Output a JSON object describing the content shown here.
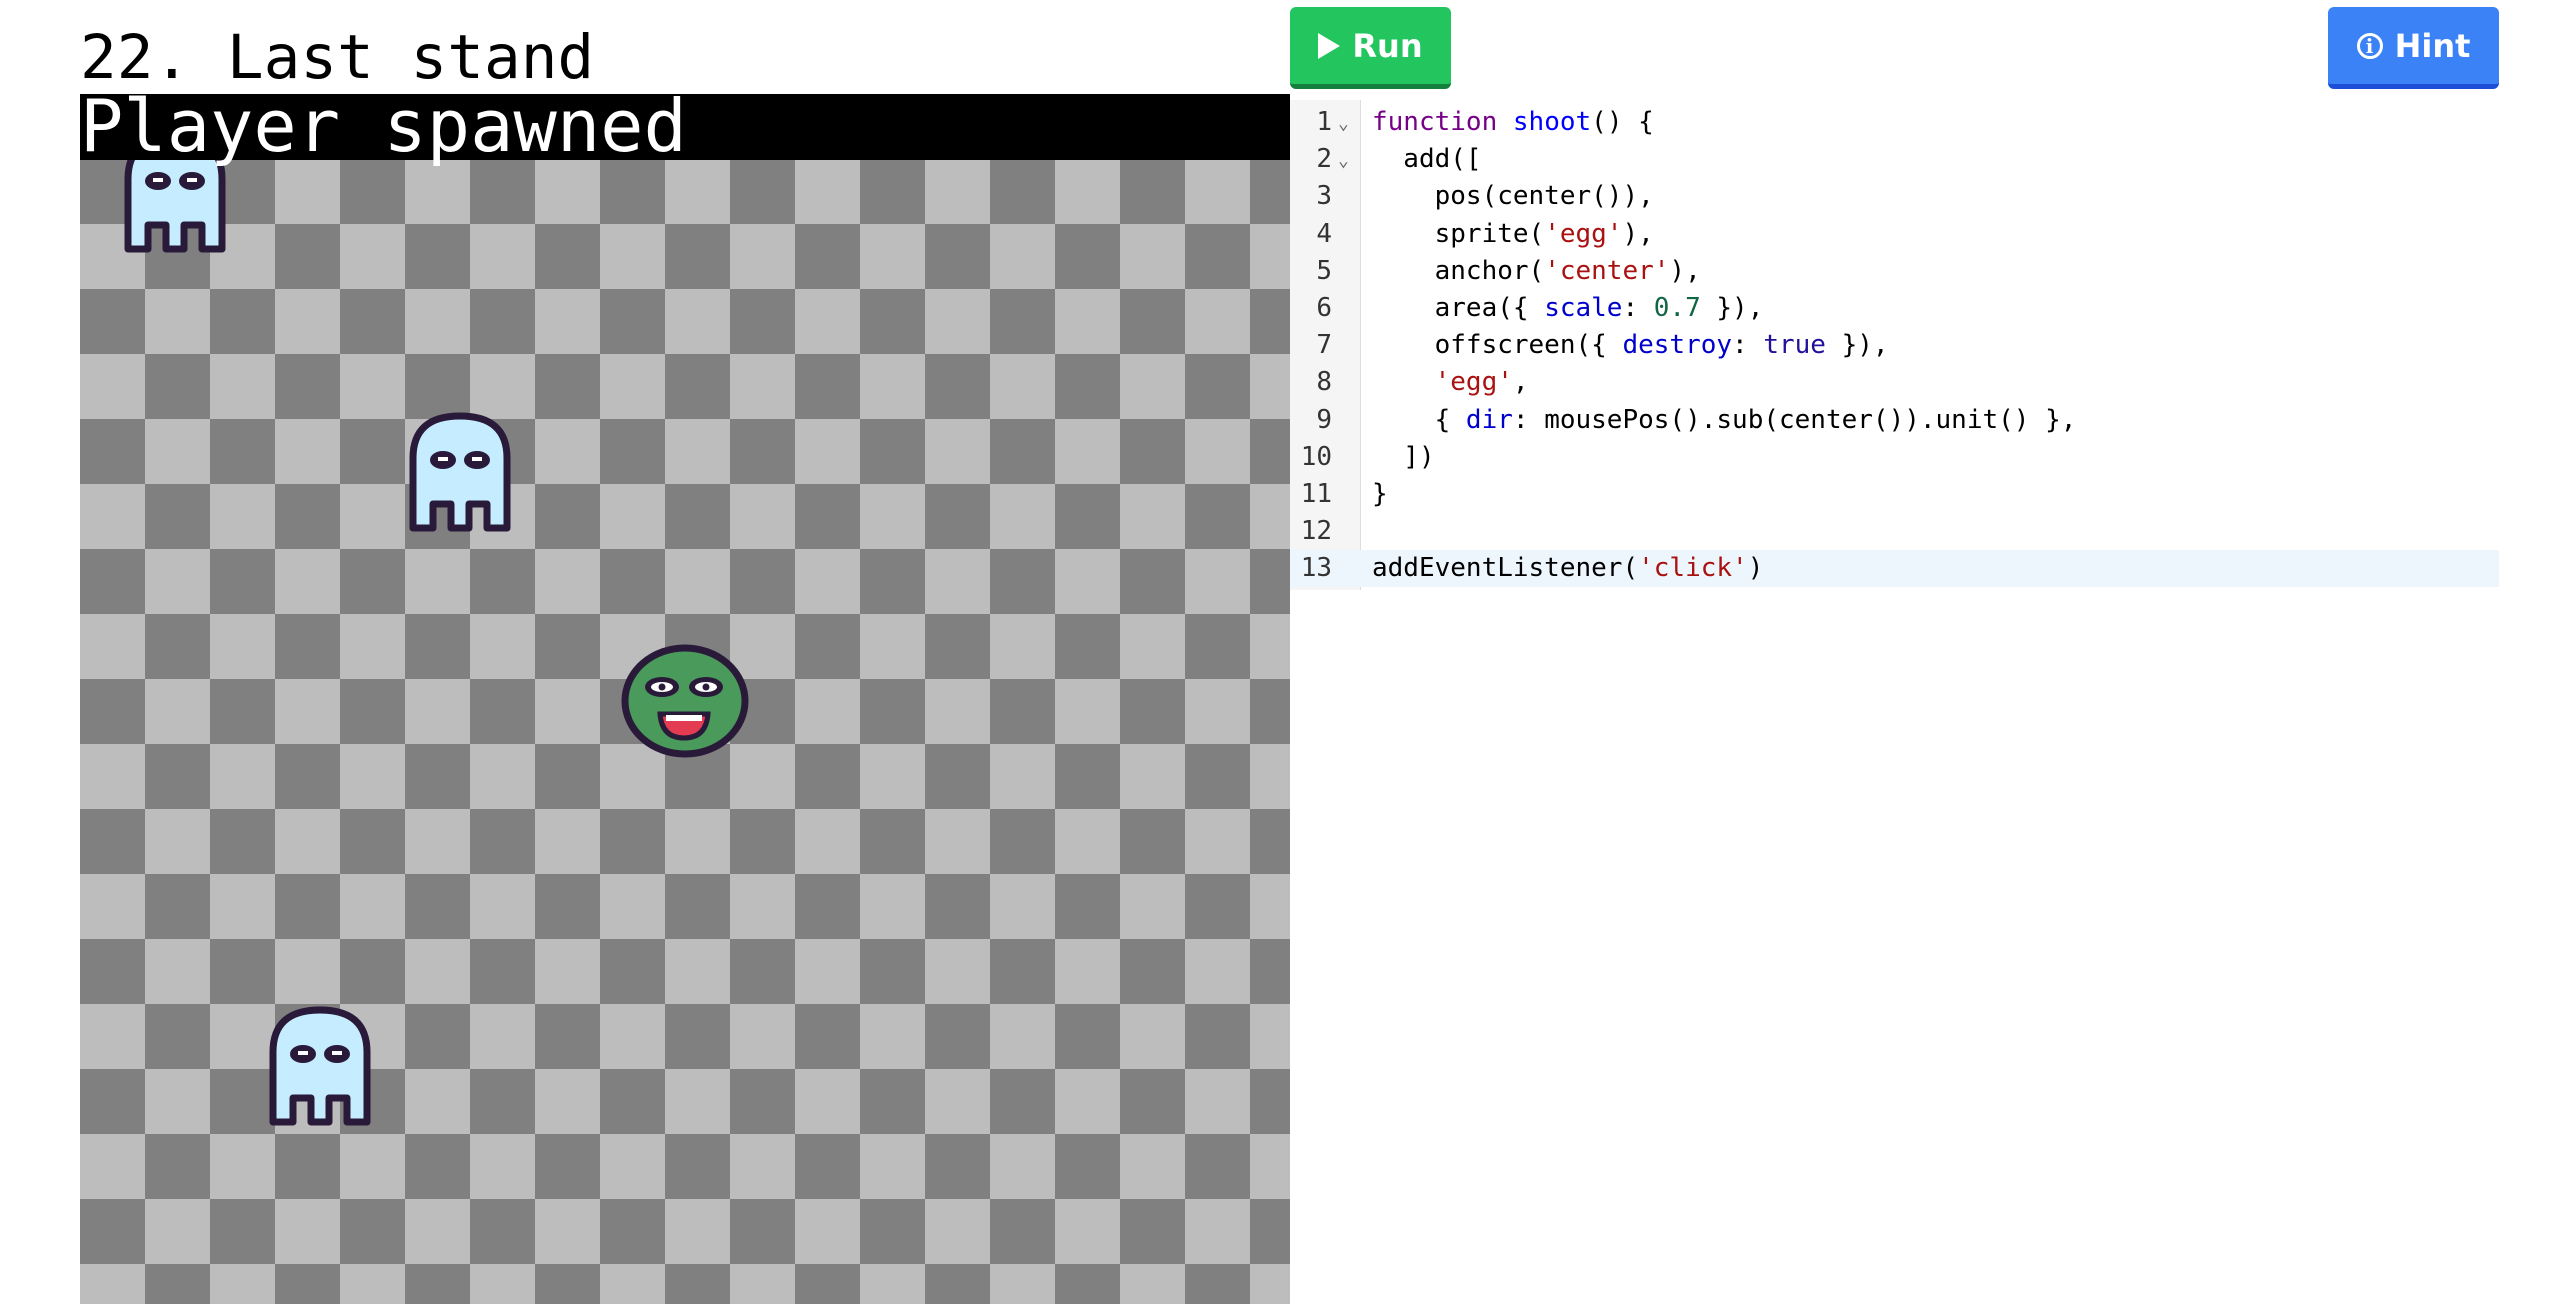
{
  "title": "22. Last stand",
  "status": "Player spawned",
  "buttons": {
    "run": "Run",
    "hint": "Hint"
  },
  "game": {
    "colors": {
      "checker_dark": "#808080",
      "checker_light": "#bdbdbd",
      "ghosty": "#c5ecff",
      "player": "#4a9a5b"
    },
    "sprites": [
      "ghosty",
      "ghosty",
      "ghosty",
      "player"
    ]
  },
  "editor": {
    "lines": [
      {
        "n": "1",
        "fold": true,
        "tokens": [
          {
            "t": "function",
            "c": "kw"
          },
          {
            "t": " "
          },
          {
            "t": "shoot",
            "c": "fn"
          },
          {
            "t": "() {"
          }
        ]
      },
      {
        "n": "2",
        "fold": true,
        "tokens": [
          {
            "t": "  add(["
          }
        ]
      },
      {
        "n": "3",
        "tokens": [
          {
            "t": "    pos(center()),"
          }
        ]
      },
      {
        "n": "4",
        "tokens": [
          {
            "t": "    sprite("
          },
          {
            "t": "'egg'",
            "c": "str"
          },
          {
            "t": "),"
          }
        ]
      },
      {
        "n": "5",
        "tokens": [
          {
            "t": "    anchor("
          },
          {
            "t": "'center'",
            "c": "str"
          },
          {
            "t": "),"
          }
        ]
      },
      {
        "n": "6",
        "tokens": [
          {
            "t": "    area({ "
          },
          {
            "t": "scale",
            "c": "prop"
          },
          {
            "t": ": "
          },
          {
            "t": "0.7",
            "c": "num"
          },
          {
            "t": " }),"
          }
        ]
      },
      {
        "n": "7",
        "tokens": [
          {
            "t": "    offscreen({ "
          },
          {
            "t": "destroy",
            "c": "prop"
          },
          {
            "t": ": "
          },
          {
            "t": "true",
            "c": "atom"
          },
          {
            "t": " }),"
          }
        ]
      },
      {
        "n": "8",
        "tokens": [
          {
            "t": "    "
          },
          {
            "t": "'egg'",
            "c": "str"
          },
          {
            "t": ","
          }
        ]
      },
      {
        "n": "9",
        "tokens": [
          {
            "t": "    { "
          },
          {
            "t": "dir",
            "c": "prop"
          },
          {
            "t": ": mousePos().sub(center()).unit() },"
          }
        ]
      },
      {
        "n": "10",
        "tokens": [
          {
            "t": "  ])"
          }
        ]
      },
      {
        "n": "11",
        "tokens": [
          {
            "t": "}"
          }
        ]
      },
      {
        "n": "12",
        "tokens": []
      },
      {
        "n": "13",
        "active": true,
        "tokens": [
          {
            "t": "addEventListener("
          },
          {
            "t": "'click'",
            "c": "str"
          },
          {
            "t": ")"
          }
        ]
      }
    ]
  }
}
